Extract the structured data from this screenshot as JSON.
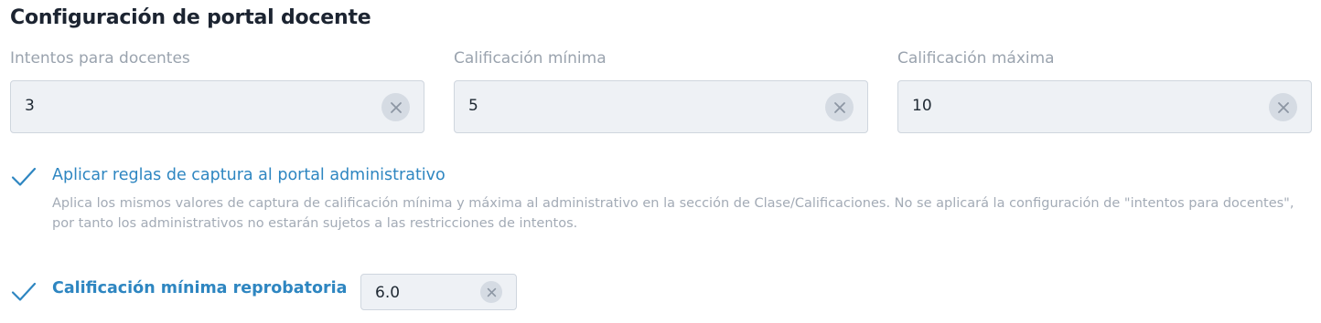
{
  "section": {
    "title": "Configuración de portal docente"
  },
  "fields": [
    {
      "label": "Intentos para docentes",
      "value": "3"
    },
    {
      "label": "Calificación mínima",
      "value": "5"
    },
    {
      "label": "Calificación máxima",
      "value": "10"
    }
  ],
  "capture_rules": {
    "checked": true,
    "title": "Aplicar reglas de captura al portal administrativo",
    "description": "Aplica los mismos valores de captura de calificación mínima y máxima al administrativo en la sección de Clase/Calificaciones. No se aplicará la configuración de \"intentos para docentes\", por tanto los administrativos no estarán sujetos a las restricciones de intentos."
  },
  "failing_grade": {
    "checked": true,
    "label": "Calificación mínima reprobatoria",
    "value": "6.0"
  },
  "icons": {
    "check": "check-icon",
    "clear": "close-icon"
  },
  "colors": {
    "accent": "#2e86c1",
    "label_gray": "#9aa3ae",
    "input_bg": "#eef1f5",
    "clear_bg": "#d5dbe3"
  }
}
